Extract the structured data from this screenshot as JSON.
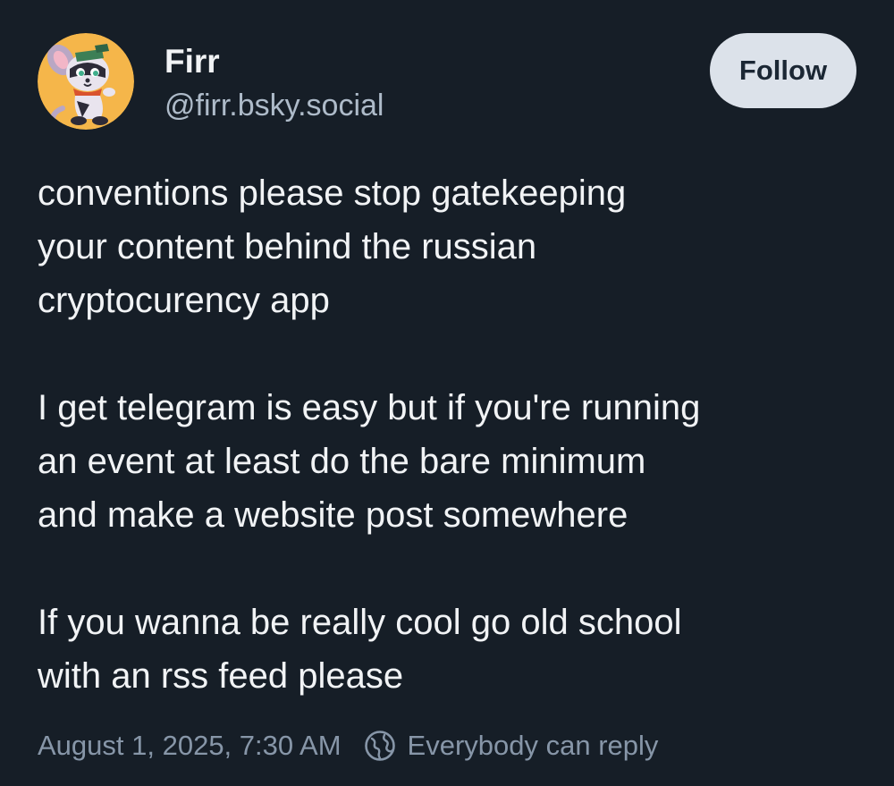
{
  "author": {
    "name": "Firr",
    "handle": "@firr.bsky.social"
  },
  "follow_button": {
    "label": "Follow"
  },
  "post": {
    "paragraphs": [
      "conventions please stop gatekeeping\nyour content behind the russian\ncryptocurency app",
      "I get telegram is easy but if you're running\nan event at least do the bare minimum\nand make a website post somewhere",
      "If you wanna be really cool go old school\nwith an rss feed please"
    ]
  },
  "meta": {
    "timestamp": "August 1, 2025, 7:30 AM",
    "reply_setting": "Everybody can reply",
    "reply_icon": "globe-icon"
  },
  "colors": {
    "background": "#161e27",
    "text": "#f1f3f5",
    "handle": "#aebbc9",
    "meta": "#8796a8",
    "follow_bg": "#dce2ea",
    "follow_text": "#1b2734",
    "avatar_bg": "#f5b64a"
  }
}
